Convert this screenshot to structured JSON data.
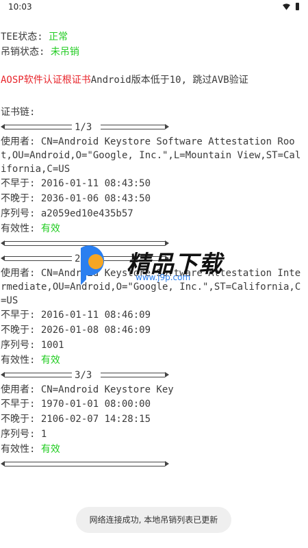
{
  "status_bar": {
    "time": "10:03"
  },
  "status": {
    "tee_label": "TEE状态: ",
    "tee_value": "正常",
    "revoke_label": "吊销状态: ",
    "revoke_value": "未吊销"
  },
  "warning": {
    "red_part": "AOSP软件认证根证书",
    "rest": "Android版本低于10, 跳过AVB验证"
  },
  "chain_title": "证书链:",
  "certificates": [
    {
      "index": "1/3",
      "subject_label": "使用者: ",
      "subject": "CN=Android Keystore Software Attestation Root,OU=Android,O=\"Google, Inc.\",L=Mountain View,ST=California,C=US",
      "not_before_label": "不早于: ",
      "not_before": "2016-01-11 08:43:50",
      "not_after_label": "不晚于: ",
      "not_after": "2036-01-06 08:43:50",
      "serial_label": "序列号: ",
      "serial": "a2059ed10e435b57",
      "validity_label": "有效性: ",
      "validity": "有效"
    },
    {
      "index": "2/3",
      "subject_label": "使用者: ",
      "subject": "CN=Android Keystore Software Attestation Intermediate,OU=Android,O=\"Google, Inc.\",ST=California,C=US",
      "not_before_label": "不早于: ",
      "not_before": "2016-01-11 08:46:09",
      "not_after_label": "不晚于: ",
      "not_after": "2026-01-08 08:46:09",
      "serial_label": "序列号: ",
      "serial": "1001",
      "validity_label": "有效性: ",
      "validity": "有效"
    },
    {
      "index": "3/3",
      "subject_label": "使用者: ",
      "subject": "CN=Android Keystore Key",
      "not_before_label": "不早于: ",
      "not_before": "1970-01-01 08:00:00",
      "not_after_label": "不晚于: ",
      "not_after": "2106-02-07 14:28:15",
      "serial_label": "序列号: ",
      "serial": "1",
      "validity_label": "有效性: ",
      "validity": "有效"
    }
  ],
  "watermark": {
    "brand": "精品下载",
    "url": "www.j9p.com"
  },
  "toast": "网络连接成功, 本地吊销列表已更新",
  "colors": {
    "ok": "#22cc22",
    "warn": "#e8262c",
    "text": "#3a3a3a",
    "toast_bg": "#efefef"
  },
  "icons": [
    "wifi-icon",
    "battery-icon",
    "watermark-logo-icon"
  ]
}
